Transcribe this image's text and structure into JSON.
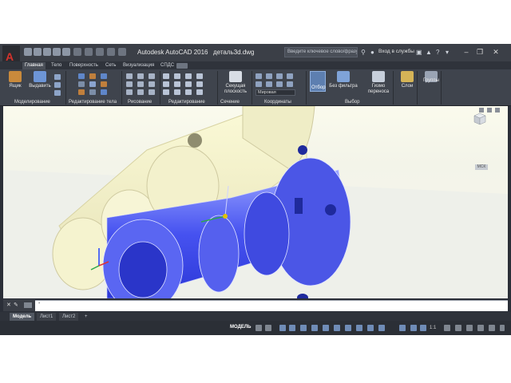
{
  "window": {
    "app_title": "Autodesk AutoCAD 2016",
    "file_name": "деталь3d.dwg",
    "search_placeholder": "Введите ключевое слово/фразу",
    "sign_in": "Вход в службы"
  },
  "tabs": [
    "Главная",
    "Тело",
    "Поверхность",
    "Сеть",
    "Визуализация",
    "СПДС"
  ],
  "ribbon": {
    "buttons": {
      "box": "Ящик",
      "extrude": "Выдавить",
      "section_plane": "Секущая плоскость",
      "select": "Отбор",
      "no_filter": "Без фильтра",
      "gizmo": "Гизмо переноса",
      "layers": "Слои",
      "groups": "Группы"
    },
    "visual_style": "Мировая",
    "panels": [
      "Моделирование",
      "Редактирование тела",
      "Рисование",
      "Редактирование",
      "Сечение",
      "Координаты",
      "Выбор"
    ]
  },
  "viewport": {
    "wcs_label": "МСК",
    "model_colors": {
      "solid": "#4b56e6",
      "highlight": "#dfe3ff",
      "cream": "#f4f2c8"
    }
  },
  "command": {
    "prompt": "-"
  },
  "layout_tabs": [
    "Модель",
    "Лист1",
    "Лист2",
    "+"
  ],
  "status": {
    "model": "МОДЕЛЬ",
    "scale": "1:1"
  }
}
